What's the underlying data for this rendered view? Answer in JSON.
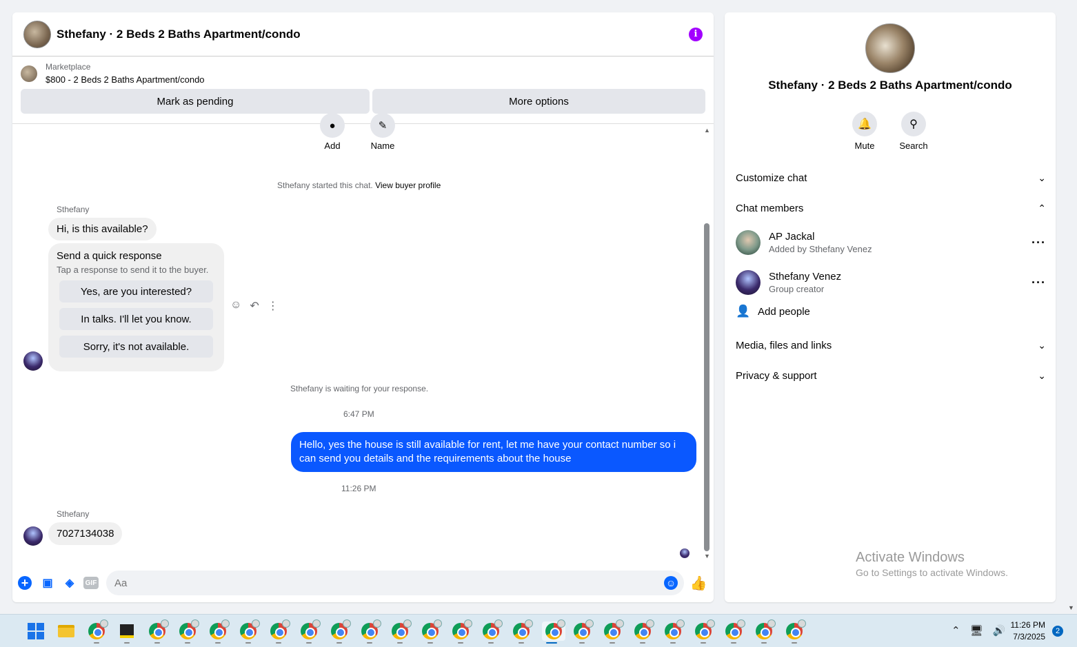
{
  "chat": {
    "title": "Sthefany · 2 Beds 2 Baths Apartment/condo",
    "info_icon": "info-icon"
  },
  "marketplace": {
    "label": "Marketplace",
    "listing": "$800 - 2 Beds 2 Baths Apartment/condo",
    "mark_pending": "Mark as pending",
    "more_options": "More options"
  },
  "top_actions": {
    "add": "Add",
    "name": "Name"
  },
  "messages": {
    "started": "Sthefany started this chat. ",
    "view_profile": "View buyer profile",
    "sender1": "Sthefany",
    "msg1": "Hi, is this available?",
    "quick_title": "Send a quick response",
    "quick_sub": "Tap a response to send it to the buyer.",
    "quick_options": [
      "Yes, are you interested?",
      "In talks. I'll let you know.",
      "Sorry, it's not available."
    ],
    "waiting": "Sthefany is waiting for your response.",
    "time1": "6:47 PM",
    "reply": "Hello, yes the house is still available for rent, let me have your contact number so i can send you details and the requirements about the house",
    "time2": "11:26 PM",
    "sender2": "Sthefany",
    "msg2": "7027134038"
  },
  "composer": {
    "placeholder": "Aa",
    "gif": "GIF"
  },
  "info_panel": {
    "title": "Sthefany · 2 Beds 2 Baths Apartment/condo",
    "mute": "Mute",
    "search": "Search",
    "customize": "Customize chat",
    "members_header": "Chat members",
    "members": [
      {
        "name": "AP Jackal",
        "sub": "Added by Sthefany Venez"
      },
      {
        "name": "Sthefany Venez",
        "sub": "Group creator"
      }
    ],
    "add_people": "Add people",
    "media": "Media, files and links",
    "privacy": "Privacy & support",
    "activate_line1": "Activate Windows",
    "activate_line2": "Go to Settings to activate Windows."
  },
  "taskbar": {
    "time": "11:26 PM",
    "date": "7/3/2025",
    "notifications": "2"
  }
}
